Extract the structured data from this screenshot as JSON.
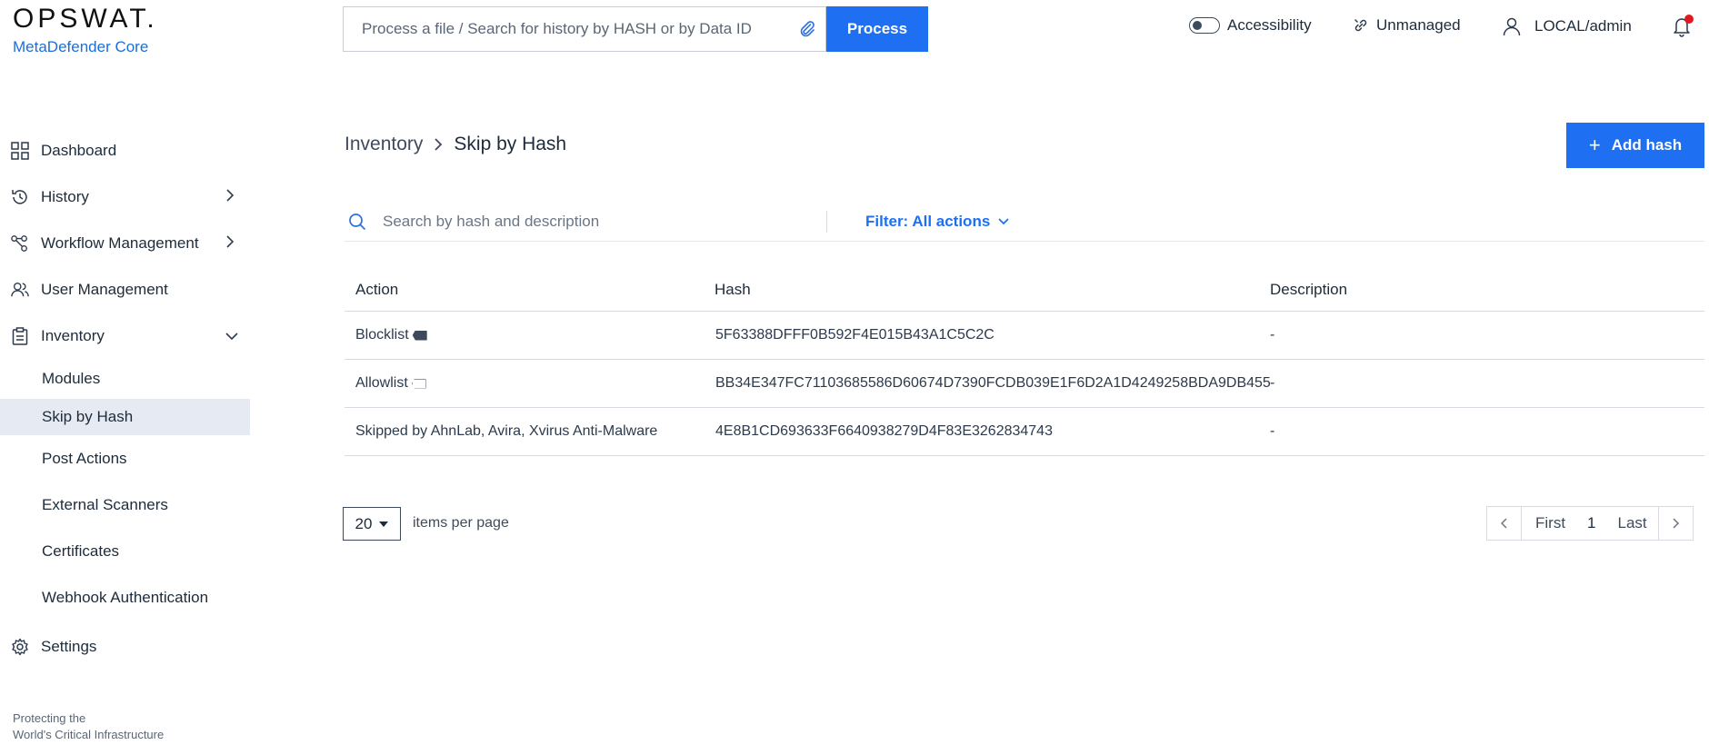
{
  "brand": {
    "logo": "OPSWAT.",
    "product": "MetaDefender Core"
  },
  "topbar": {
    "search_placeholder": "Process a file / Search for history by HASH or by Data ID",
    "process_label": "Process",
    "accessibility_label": "Accessibility",
    "unmanaged_label": "Unmanaged",
    "user_label": "LOCAL/admin",
    "notification_dot_color": "#e0191f"
  },
  "sidebar": {
    "items": [
      {
        "label": "Dashboard",
        "icon": "grid-icon"
      },
      {
        "label": "History",
        "icon": "history-icon"
      },
      {
        "label": "Workflow Management",
        "icon": "workflow-icon"
      },
      {
        "label": "User Management",
        "icon": "users-icon"
      },
      {
        "label": "Inventory",
        "icon": "clipboard-icon"
      }
    ],
    "inventory_sub": [
      {
        "label": "Modules"
      },
      {
        "label": "Skip by Hash"
      },
      {
        "label": "Post Actions"
      },
      {
        "label": "External Scanners"
      },
      {
        "label": "Certificates"
      },
      {
        "label": "Webhook Authentication"
      }
    ],
    "settings_label": "Settings",
    "footer_line1": "Protecting the",
    "footer_line2": "World's Critical Infrastructure"
  },
  "main": {
    "breadcrumb": {
      "parent": "Inventory",
      "current": "Skip by Hash"
    },
    "add_label": "Add hash",
    "search_placeholder": "Search by hash and description",
    "filter_label": "Filter: All actions",
    "columns": {
      "action": "Action",
      "hash": "Hash",
      "description": "Description"
    },
    "rows": [
      {
        "action": "Blocklist",
        "tag": "dark",
        "hash": "5F63388DFFF0B592F4E015B43A1C5C2C",
        "description": "-"
      },
      {
        "action": "Allowlist",
        "tag": "light",
        "hash": "BB34E347FC71103685586D60674D7390FCDB039E1F6D2A1D4249258BDA9DB455",
        "description": "-"
      },
      {
        "action": "Skipped by AhnLab, Avira, Xvirus Anti-Malware",
        "tag": "",
        "hash": "4E8B1CD693633F6640938279D4F83E3262834743",
        "description": "-"
      }
    ],
    "page_size": "20",
    "per_page_label": "items per page",
    "pagination": {
      "first": "First",
      "page": "1",
      "last": "Last"
    }
  },
  "colors": {
    "accent": "#1f6ff2",
    "text": "#1d2b3a"
  }
}
